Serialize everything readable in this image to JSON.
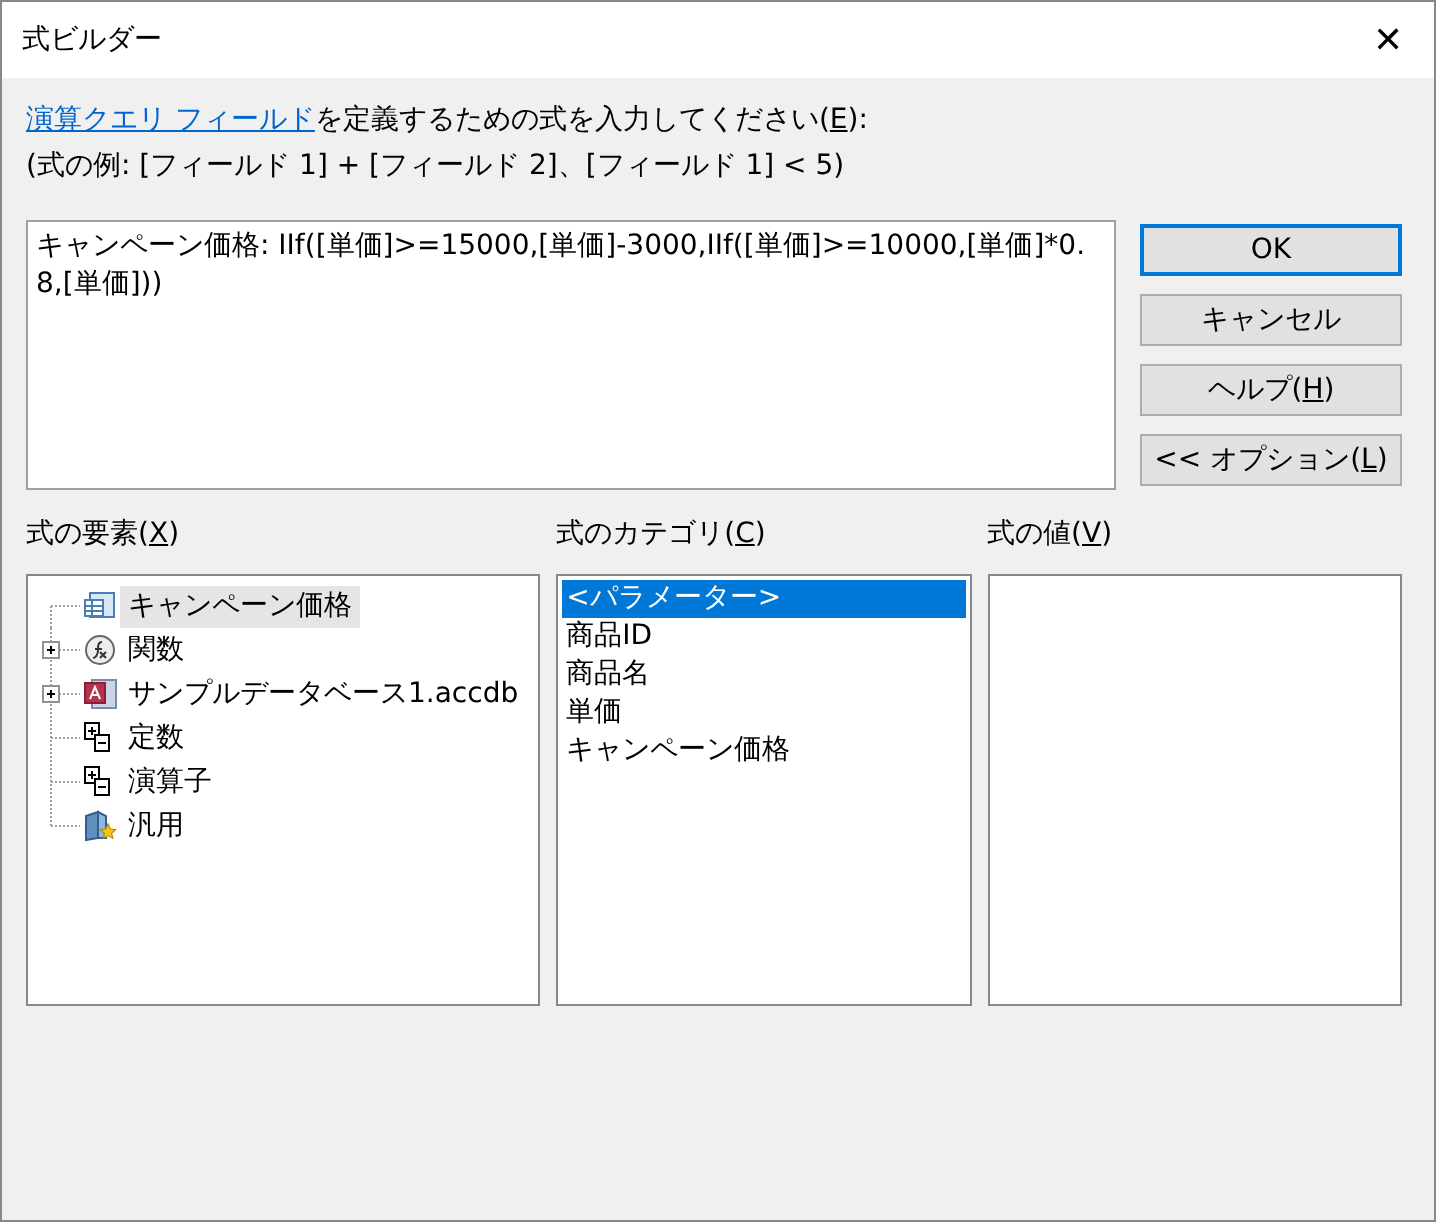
{
  "window": {
    "title": "式ビルダー",
    "close": "✕"
  },
  "prompt": {
    "link": "演算クエリ フィールド",
    "before": "を定義するための式を入力してください(",
    "key": "E",
    "after": "):"
  },
  "example": "(式の例: [フィールド 1] + [フィールド 2]、[フィールド 1] < 5)",
  "expression": "キャンペーン価格: IIf([単価]>=15000,[単価]-3000,IIf([単価]>=10000,[単価]*0.8,[単価]))",
  "buttons": [
    {
      "before": "OK",
      "default": true
    },
    {
      "before": "キャンセル",
      "default": false
    },
    {
      "before": "ヘルプ(",
      "key": "H",
      "after": ")",
      "default": false
    },
    {
      "before": "<< オプション(",
      "key": "L",
      "after": ")",
      "default": false
    }
  ],
  "elements": {
    "label": {
      "before": "式の要素(",
      "key": "X",
      "after": ")"
    },
    "items": [
      {
        "kind": "field",
        "label": "キャンペーン価格",
        "selected": true,
        "collapsed": false
      },
      {
        "kind": "function",
        "label": "関数",
        "selected": false,
        "collapsed": true
      },
      {
        "kind": "database",
        "label": "サンプルデータベース1.accdb",
        "selected": false,
        "collapsed": true
      },
      {
        "kind": "constant",
        "label": "定数",
        "selected": false,
        "collapsed": false
      },
      {
        "kind": "constant",
        "label": "演算子",
        "selected": false,
        "collapsed": false
      },
      {
        "kind": "general",
        "label": "汎用",
        "selected": false,
        "collapsed": false
      }
    ]
  },
  "categories": {
    "label": {
      "before": "式のカテゴリ(",
      "key": "C",
      "after": ")"
    },
    "items": [
      {
        "label": "<パラメーター>",
        "selected": true
      },
      {
        "label": "商品ID",
        "selected": false
      },
      {
        "label": "商品名",
        "selected": false
      },
      {
        "label": "単価",
        "selected": false
      },
      {
        "label": "キャンペーン価格",
        "selected": false
      }
    ]
  },
  "values": {
    "label": {
      "before": "式の値(",
      "key": "V",
      "after": ")"
    }
  }
}
